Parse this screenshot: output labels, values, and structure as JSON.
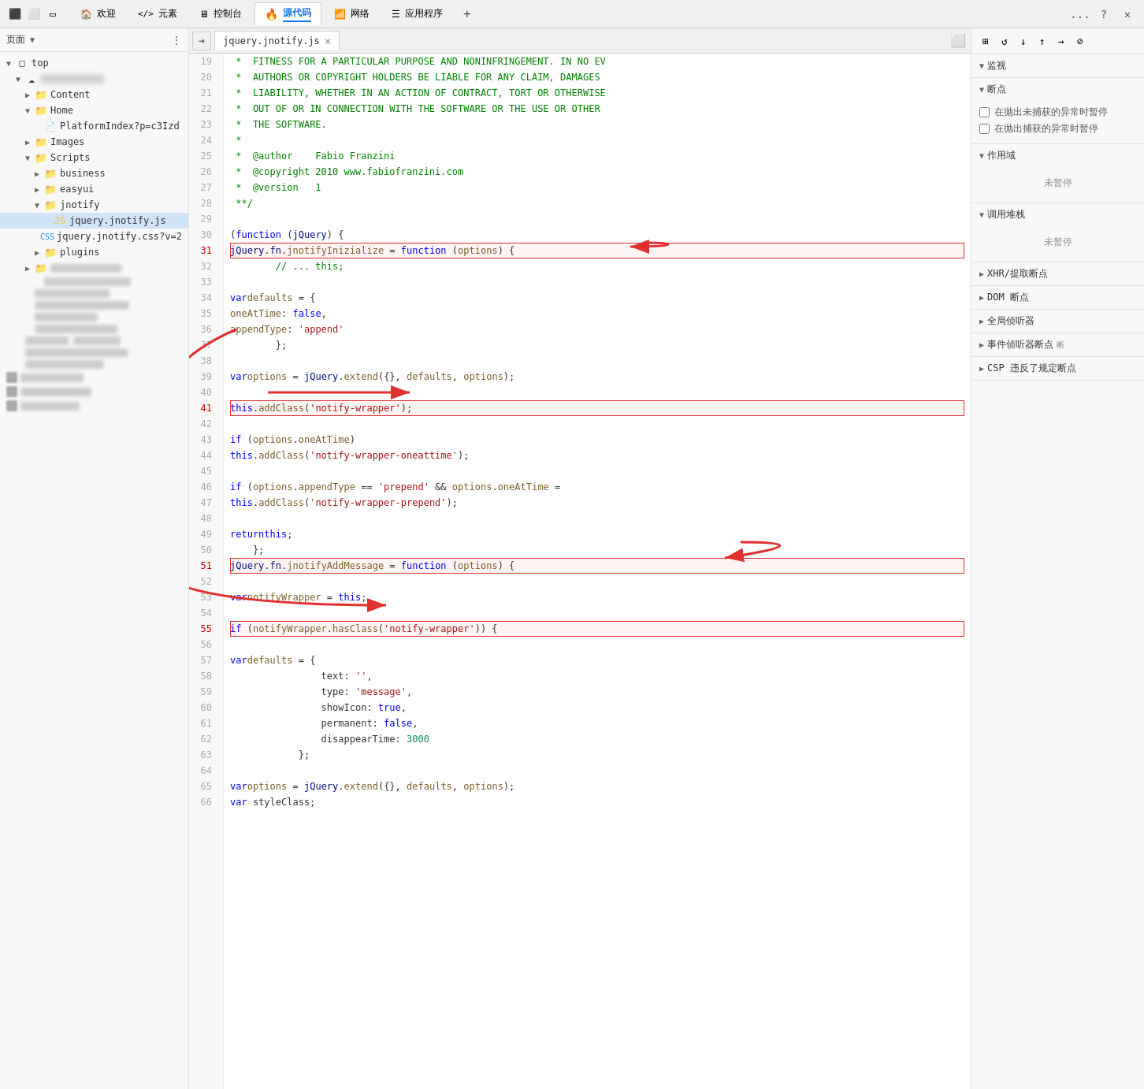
{
  "browser": {
    "tabs": [
      {
        "id": "welcome",
        "label": "欢迎",
        "icon": "🏠",
        "active": false
      },
      {
        "id": "elements",
        "label": "元素",
        "icon": "</>",
        "active": false
      },
      {
        "id": "console",
        "label": "控制台",
        "icon": "🖥",
        "active": false
      },
      {
        "id": "sources",
        "label": "源代码",
        "icon": "🔥",
        "active": true
      },
      {
        "id": "network",
        "label": "网络",
        "icon": "📶",
        "active": false
      },
      {
        "id": "application",
        "label": "应用程序",
        "icon": "☰",
        "active": false
      }
    ],
    "more_btn": "...",
    "help_btn": "?",
    "close_btn": "✕"
  },
  "sidebar": {
    "header_label": "页面",
    "root": "top",
    "items": [
      {
        "id": "top",
        "label": "top",
        "level": 0,
        "type": "root",
        "expanded": true
      },
      {
        "id": "cloud",
        "label": "",
        "level": 1,
        "type": "folder",
        "expanded": true,
        "blurred": true
      },
      {
        "id": "content",
        "label": "Content",
        "level": 2,
        "type": "folder",
        "expanded": false
      },
      {
        "id": "home",
        "label": "Home",
        "level": 2,
        "type": "folder",
        "expanded": true
      },
      {
        "id": "platformindex",
        "label": "PlatformIndex?p=c3Izd",
        "level": 3,
        "type": "file",
        "blurred": false
      },
      {
        "id": "images",
        "label": "Images",
        "level": 2,
        "type": "folder",
        "expanded": false
      },
      {
        "id": "scripts",
        "label": "Scripts",
        "level": 2,
        "type": "folder",
        "expanded": true
      },
      {
        "id": "business",
        "label": "business",
        "level": 3,
        "type": "folder",
        "expanded": false
      },
      {
        "id": "easyui",
        "label": "easyui",
        "level": 3,
        "type": "folder",
        "expanded": false
      },
      {
        "id": "jnotify",
        "label": "jnotify",
        "level": 3,
        "type": "folder",
        "expanded": true
      },
      {
        "id": "jquery.jnotify.js",
        "label": "jquery.jnotify.js",
        "level": 4,
        "type": "file-js",
        "selected": true
      },
      {
        "id": "jquery.jnotify.css",
        "label": "jquery.jnotify.css?v=2",
        "level": 4,
        "type": "file-css"
      },
      {
        "id": "plugins",
        "label": "plugins",
        "level": 3,
        "type": "folder",
        "expanded": false
      },
      {
        "id": "blurred1",
        "label": "",
        "level": 2,
        "type": "folder",
        "blurred": true
      },
      {
        "id": "blurred2",
        "label": "",
        "level": 3,
        "type": "item",
        "blurred": true
      },
      {
        "id": "blurred3",
        "label": "",
        "level": 3,
        "type": "item",
        "blurred": true
      },
      {
        "id": "blurred4",
        "label": "",
        "level": 3,
        "type": "item",
        "blurred": true
      },
      {
        "id": "blurred5",
        "label": "",
        "level": 3,
        "type": "item",
        "blurred": true
      },
      {
        "id": "blurred6",
        "label": "",
        "level": 3,
        "type": "item",
        "blurred": true
      },
      {
        "id": "blurred7",
        "label": "",
        "level": 2,
        "type": "item",
        "blurred": true
      },
      {
        "id": "blurred8",
        "label": "",
        "level": 2,
        "type": "item",
        "blurred": true
      },
      {
        "id": "blurred9",
        "label": "",
        "level": 2,
        "type": "item",
        "blurred": true
      },
      {
        "id": "blurred10",
        "label": "",
        "level": 2,
        "type": "item",
        "blurred": true
      },
      {
        "id": "blurred11",
        "label": "",
        "level": 2,
        "type": "item",
        "blurred": true
      },
      {
        "id": "blurred12",
        "label": "",
        "level": 2,
        "type": "item",
        "blurred": true
      }
    ]
  },
  "editor": {
    "filename": "jquery.jnotify.js",
    "lines": [
      {
        "num": 19,
        "content": " *  FITNESS FOR A PARTICULAR PURPOSE AND NONINFRINGEMENT. IN NO EV",
        "type": "comment"
      },
      {
        "num": 20,
        "content": " *  AUTHORS OR COPYRIGHT HOLDERS BE LIABLE FOR ANY CLAIM, DAMAGES",
        "type": "comment"
      },
      {
        "num": 21,
        "content": " *  LIABILITY, WHETHER IN AN ACTION OF CONTRACT, TORT OR OTHERWISE",
        "type": "comment"
      },
      {
        "num": 22,
        "content": " *  OUT OF OR IN CONNECTION WITH THE SOFTWARE OR THE USE OR OTHER",
        "type": "comment"
      },
      {
        "num": 23,
        "content": " *  THE SOFTWARE.",
        "type": "comment"
      },
      {
        "num": 24,
        "content": " *",
        "type": "comment"
      },
      {
        "num": 25,
        "content": " *  @author    Fabio Franzini",
        "type": "comment"
      },
      {
        "num": 26,
        "content": " *  @copyright 2010 www.fabiofranzini.com",
        "type": "comment"
      },
      {
        "num": 27,
        "content": " *  @version   1",
        "type": "comment"
      },
      {
        "num": 28,
        "content": " **/",
        "type": "comment"
      },
      {
        "num": 29,
        "content": "",
        "type": "blank"
      },
      {
        "num": 30,
        "content": "(function (jQuery) {",
        "type": "code"
      },
      {
        "num": 31,
        "content": "    jQuery.fn.jnotifyInizialize = function (options) {",
        "type": "highlight1"
      },
      {
        "num": 32,
        "content": "        // ... this;",
        "type": "comment"
      },
      {
        "num": 33,
        "content": "",
        "type": "blank"
      },
      {
        "num": 34,
        "content": "        var defaults = {",
        "type": "code"
      },
      {
        "num": 35,
        "content": "            oneAtTime: false,",
        "type": "code"
      },
      {
        "num": 36,
        "content": "            appendType: 'append'",
        "type": "code"
      },
      {
        "num": 37,
        "content": "        };",
        "type": "code"
      },
      {
        "num": 38,
        "content": "",
        "type": "blank"
      },
      {
        "num": 39,
        "content": "        var options = jQuery.extend({}, defaults, options);",
        "type": "code"
      },
      {
        "num": 40,
        "content": "",
        "type": "blank"
      },
      {
        "num": 41,
        "content": "        this.addClass('notify-wrapper');",
        "type": "highlight2"
      },
      {
        "num": 42,
        "content": "",
        "type": "blank"
      },
      {
        "num": 43,
        "content": "        if (options.oneAtTime)",
        "type": "code"
      },
      {
        "num": 44,
        "content": "            this.addClass('notify-wrapper-oneattime');",
        "type": "code"
      },
      {
        "num": 45,
        "content": "",
        "type": "blank"
      },
      {
        "num": 46,
        "content": "        if (options.appendType == 'prepend' && options.oneAtTime =",
        "type": "code"
      },
      {
        "num": 47,
        "content": "            this.addClass('notify-wrapper-prepend');",
        "type": "code"
      },
      {
        "num": 48,
        "content": "",
        "type": "blank"
      },
      {
        "num": 49,
        "content": "        return this;",
        "type": "code"
      },
      {
        "num": 50,
        "content": "    };",
        "type": "code"
      },
      {
        "num": 51,
        "content": "    jQuery.fn.jnotifyAddMessage = function (options) {",
        "type": "highlight3"
      },
      {
        "num": 52,
        "content": "",
        "type": "blank"
      },
      {
        "num": 53,
        "content": "        var notifyWrapper = this;",
        "type": "code"
      },
      {
        "num": 54,
        "content": "",
        "type": "blank"
      },
      {
        "num": 55,
        "content": "        if (notifyWrapper.hasClass('notify-wrapper')) {",
        "type": "highlight4"
      },
      {
        "num": 56,
        "content": "",
        "type": "blank"
      },
      {
        "num": 57,
        "content": "            var defaults = {",
        "type": "code"
      },
      {
        "num": 58,
        "content": "                text: '',",
        "type": "code"
      },
      {
        "num": 59,
        "content": "                type: 'message',",
        "type": "code"
      },
      {
        "num": 60,
        "content": "                showIcon: true,",
        "type": "code"
      },
      {
        "num": 61,
        "content": "                permanent: false,",
        "type": "code"
      },
      {
        "num": 62,
        "content": "                disappearTime: 3000",
        "type": "code"
      },
      {
        "num": 63,
        "content": "            };",
        "type": "code"
      },
      {
        "num": 64,
        "content": "",
        "type": "blank"
      },
      {
        "num": 65,
        "content": "            var options = jQuery.extend({}, defaults, options);",
        "type": "code"
      },
      {
        "num": 66,
        "content": "            var styleClass;",
        "type": "code"
      }
    ],
    "highlights": [
      {
        "line": 31,
        "label": "highlight-line-31"
      },
      {
        "line": 41,
        "label": "highlight-line-41"
      },
      {
        "line": 51,
        "label": "highlight-line-51"
      },
      {
        "line": 55,
        "label": "highlight-line-55"
      }
    ]
  },
  "right_panel": {
    "sections": [
      {
        "id": "monitor",
        "label": "监视",
        "expanded": true,
        "content_type": "empty"
      },
      {
        "id": "breakpoints",
        "label": "断点",
        "expanded": true,
        "content_type": "checkboxes",
        "checkboxes": [
          {
            "label": "在抛出未捕获的异常时暂停"
          },
          {
            "label": "在抛出捕获的异常时暂停"
          }
        ]
      },
      {
        "id": "scope",
        "label": "作用域",
        "expanded": true,
        "content_type": "status",
        "status": "未暂停"
      },
      {
        "id": "callstack",
        "label": "调用堆栈",
        "expanded": true,
        "content_type": "status",
        "status": "未暂停"
      },
      {
        "id": "xhr",
        "label": "XHR/提取断点",
        "expanded": false
      },
      {
        "id": "dom",
        "label": "DOM 断点",
        "expanded": false
      },
      {
        "id": "global",
        "label": "全局侦听器",
        "expanded": false
      },
      {
        "id": "event",
        "label": "事件侦听器断点",
        "expanded": false
      },
      {
        "id": "csp",
        "label": "CSP 违反了规定断点",
        "expanded": false
      }
    ]
  }
}
